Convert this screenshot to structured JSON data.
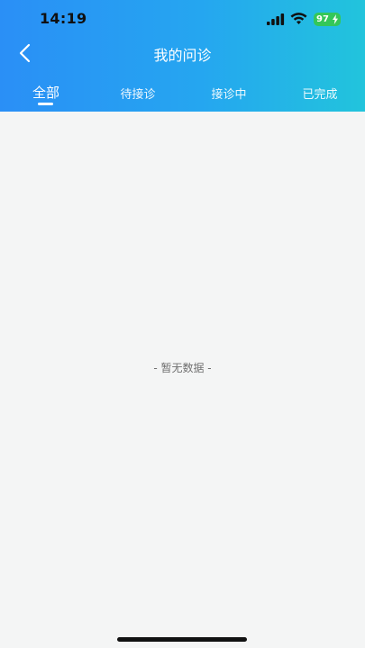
{
  "status_bar": {
    "time": "14:19",
    "battery_level": "97",
    "icons": [
      "signal-icon",
      "wifi-icon",
      "battery-icon",
      "charging-bolt-icon"
    ]
  },
  "nav": {
    "back_icon": "chevron-left-icon",
    "title": "我的问诊"
  },
  "tabs": [
    {
      "label": "全部",
      "active": true
    },
    {
      "label": "待接诊",
      "active": false
    },
    {
      "label": "接诊中",
      "active": false
    },
    {
      "label": "已完成",
      "active": false
    }
  ],
  "empty_state": {
    "text": "- 暂无数据 -"
  },
  "colors": {
    "header_gradient_start": "#2a8ff6",
    "header_gradient_end": "#22c4dc",
    "background": "#f4f5f5",
    "battery": "#34c759"
  }
}
